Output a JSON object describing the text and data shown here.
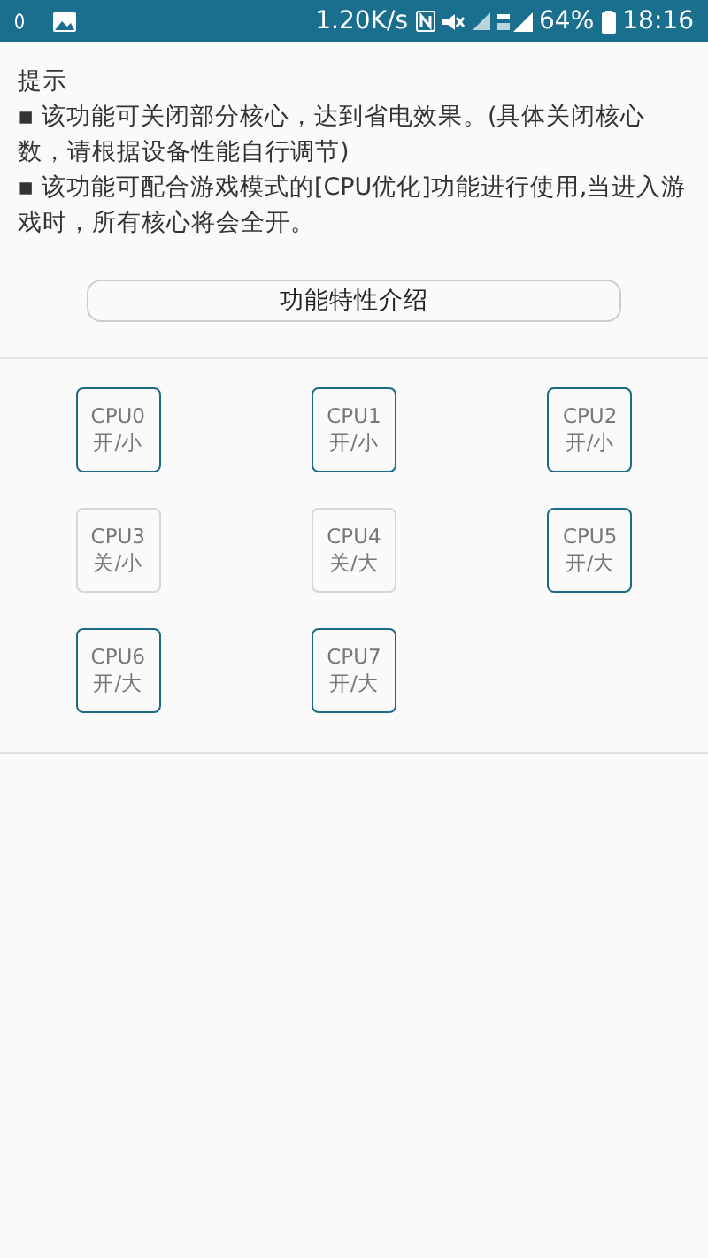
{
  "status_bar": {
    "speed": "1.20K/s",
    "battery": "64%",
    "time": "18:16"
  },
  "tips": {
    "title": "提示",
    "items": [
      "▪ 该功能可关闭部分核心，达到省电效果。(具体关闭核心数，请根据设备性能自行调节)",
      "▪ 该功能可配合游戏模式的[CPU优化]功能进行使用,当进入游戏时，所有核心将会全开。"
    ]
  },
  "intro_button": "功能特性介绍",
  "cores": [
    {
      "name": "CPU0",
      "mode": "开/小",
      "on": true
    },
    {
      "name": "CPU1",
      "mode": "开/小",
      "on": true
    },
    {
      "name": "CPU2",
      "mode": "开/小",
      "on": true
    },
    {
      "name": "CPU3",
      "mode": "关/小",
      "on": false
    },
    {
      "name": "CPU4",
      "mode": "关/大",
      "on": false
    },
    {
      "name": "CPU5",
      "mode": "开/大",
      "on": true
    },
    {
      "name": "CPU6",
      "mode": "开/大",
      "on": true
    },
    {
      "name": "CPU7",
      "mode": "开/大",
      "on": true
    }
  ]
}
